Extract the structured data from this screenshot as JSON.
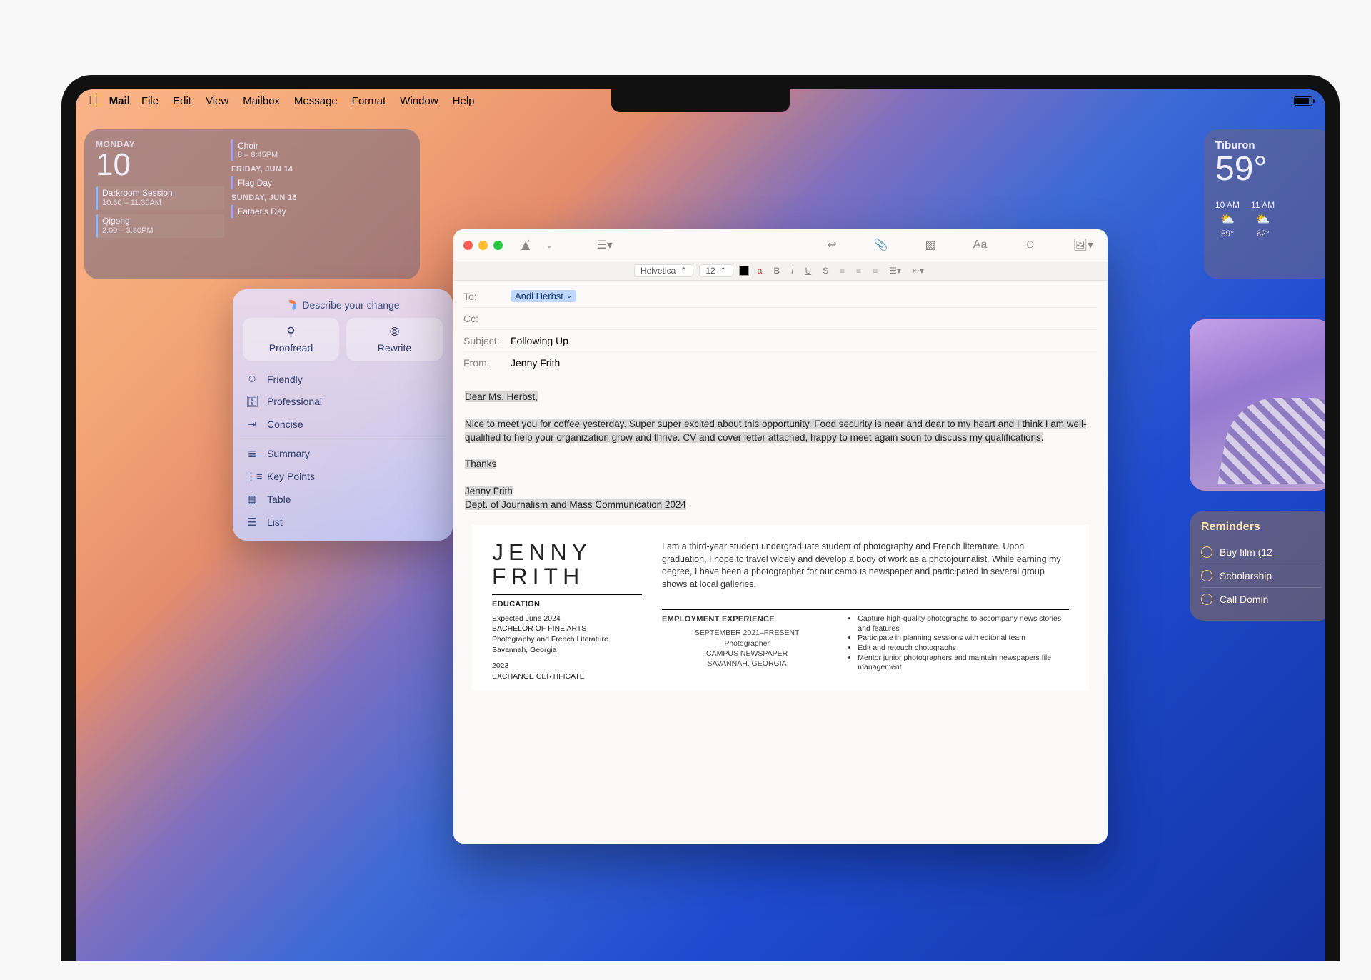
{
  "menubar": {
    "app": "Mail",
    "items": [
      "File",
      "Edit",
      "View",
      "Mailbox",
      "Message",
      "Format",
      "Window",
      "Help"
    ]
  },
  "calendar": {
    "day_label": "MONDAY",
    "day_num": "10",
    "events": [
      {
        "title": "Darkroom Session",
        "time": "10:30 – 11:30AM"
      },
      {
        "title": "Qigong",
        "time": "2:00 – 3:30PM"
      }
    ],
    "right": [
      {
        "type": "item",
        "title": "Choir",
        "time": "8 – 8:45PM"
      },
      {
        "type": "sec",
        "label": "FRIDAY, JUN 14"
      },
      {
        "type": "item",
        "title": "Flag Day",
        "time": ""
      },
      {
        "type": "sec",
        "label": "SUNDAY, JUN 16"
      },
      {
        "type": "item",
        "title": "Father's Day",
        "time": ""
      }
    ]
  },
  "weather": {
    "location": "Tiburon",
    "temp": "59°",
    "hours": [
      {
        "h": "10 AM",
        "icon": "⛅",
        "t": "59°"
      },
      {
        "h": "11 AM",
        "icon": "⛅",
        "t": "62°"
      }
    ]
  },
  "reminders": {
    "title": "Reminders",
    "items": [
      "Buy film (12",
      "Scholarship",
      "Call Domin"
    ]
  },
  "wtools": {
    "describe": "Describe your change",
    "proofread": "Proofread",
    "rewrite": "Rewrite",
    "rows": [
      "Friendly",
      "Professional",
      "Concise"
    ],
    "rows2": [
      "Summary",
      "Key Points",
      "Table",
      "List"
    ]
  },
  "mail": {
    "format": {
      "font": "Helvetica",
      "size": "12"
    },
    "to_label": "To:",
    "to_value": "Andi Herbst",
    "cc_label": "Cc:",
    "subject_label": "Subject:",
    "subject_value": "Following Up",
    "from_label": "From:",
    "from_value": "Jenny Frith",
    "body": {
      "greet": "Dear Ms. Herbst,",
      "p1": "Nice to meet you for coffee yesterday. Super super excited about this opportunity. Food security is near and dear to my heart and I think I am well-qualified to help your organization grow and thrive. CV and cover letter attached, happy to meet again soon to discuss my qualifications.",
      "thanks": "Thanks",
      "sig1": "Jenny Frith",
      "sig2": "Dept. of Journalism and Mass Communication 2024"
    },
    "cv": {
      "first": "JENNY",
      "last": "FRITH",
      "bio": "I am a third-year student undergraduate student of photography and French literature. Upon graduation, I hope to travel widely and develop a body of work as a photojournalist. While earning my degree, I have been a photographer for our campus newspaper and participated in several group shows at local galleries.",
      "edu_h": "EDUCATION",
      "edu": "Expected June 2024\nBACHELOR OF FINE ARTS\nPhotography and French Literature\nSavannah, Georgia",
      "edu2": "2023\nEXCHANGE CERTIFICATE",
      "emp_h": "EMPLOYMENT EXPERIENCE",
      "emp": "SEPTEMBER 2021–PRESENT\nPhotographer\nCAMPUS NEWSPAPER\nSAVANNAH, GEORGIA",
      "bullets": [
        "Capture high-quality photographs to accompany news stories and features",
        "Participate in planning sessions with editorial team",
        "Edit and retouch photographs",
        "Mentor junior photographers and maintain newspapers file management"
      ]
    }
  }
}
